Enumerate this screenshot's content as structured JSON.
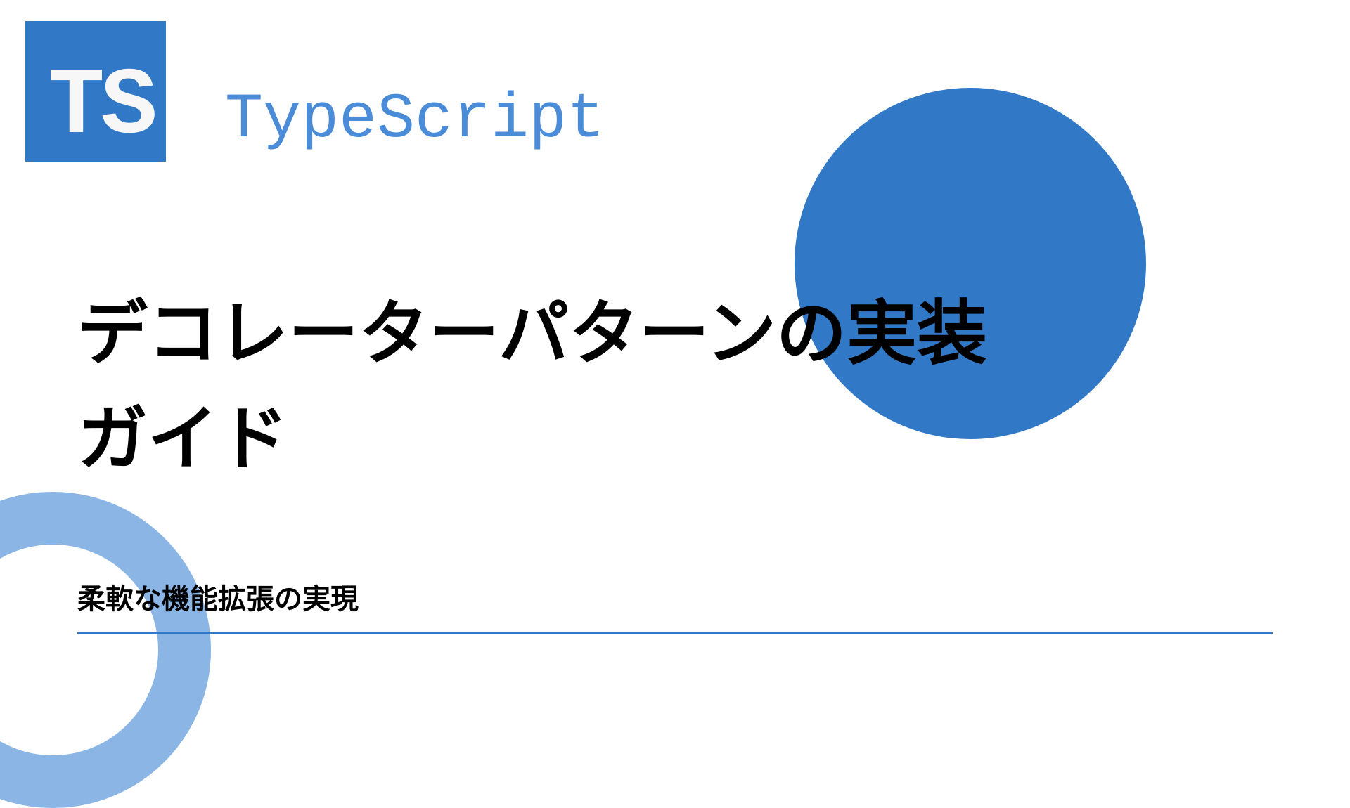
{
  "logo": {
    "text": "TS"
  },
  "header": {
    "label": "TypeScript"
  },
  "title": "デコレーターパターンの実装\nガイド",
  "subtitle": "柔軟な機能拡張の実現"
}
